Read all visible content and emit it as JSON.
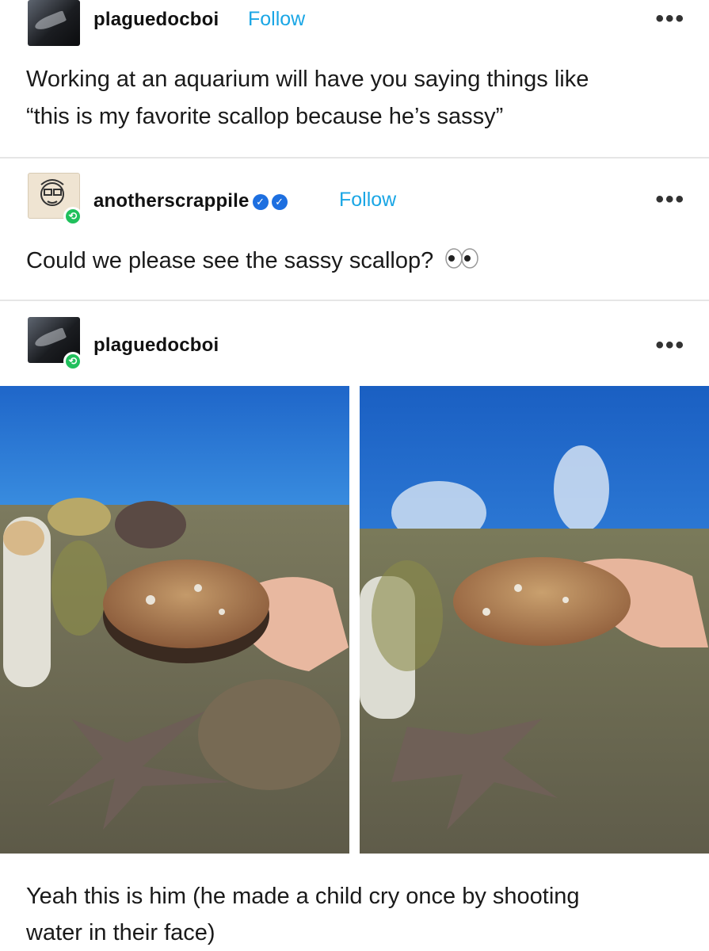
{
  "posts": [
    {
      "username": "plaguedocboi",
      "follow_label": "Follow",
      "menu": "•••",
      "text_line1": "Working at an aquarium will have you saying things like",
      "text_line2": "“this is my favorite scallop because he’s sassy”"
    },
    {
      "username": "anotherscrappile",
      "follow_label": "Follow",
      "menu": "•••",
      "text": "Could we please see the sassy scallop?"
    },
    {
      "username": "plaguedocboi",
      "menu": "•••",
      "text_line1": "Yeah this is him (he made a child cry once by shooting",
      "text_line2": "water in their face)"
    }
  ],
  "icons": {
    "reblog": "reblog-icon",
    "verified": "verified-badge-icon",
    "eyes": "eyes-emoji-icon",
    "menu": "more-options-icon"
  },
  "colors": {
    "follow": "#1aa6e5",
    "reblog_badge": "#20c05c",
    "verified": "#1d6fe0",
    "text": "#1a1a1a"
  }
}
